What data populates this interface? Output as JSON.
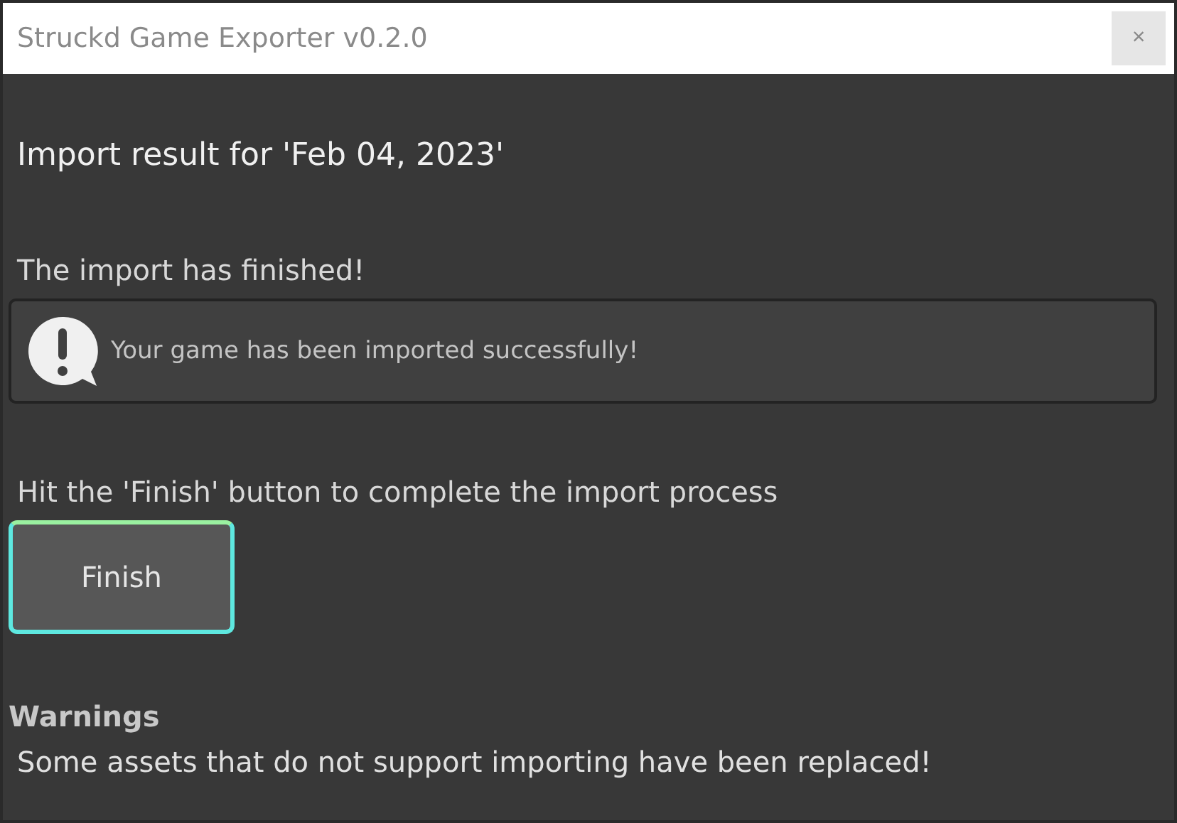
{
  "window": {
    "title": "Struckd Game Exporter v0.2.0",
    "close": "×"
  },
  "heading": "Import result for 'Feb 04, 2023'",
  "status": "The import has finished!",
  "message": {
    "kind": "info",
    "text": "Your game has been imported successfully!"
  },
  "instruction": "Hit the 'Finish' button to complete the import process",
  "finish_button": {
    "label": "Finish",
    "focused": true
  },
  "warnings": {
    "title": "Warnings",
    "text": "Some assets that do not support importing have been replaced!"
  }
}
